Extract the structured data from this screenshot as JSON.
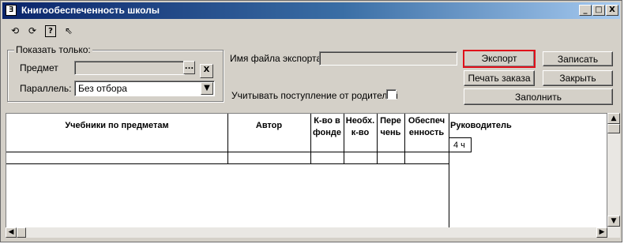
{
  "window": {
    "title": "Книгообеспеченность школы",
    "app_icon": "1c-app-icon"
  },
  "title_buttons": {
    "minimize": "_",
    "maximize": "□",
    "close": "X"
  },
  "toolbar": {
    "icons": [
      "refresh-left-icon",
      "refresh-right-icon",
      "help-icon",
      "context-help-icon"
    ]
  },
  "filter": {
    "group_label": "Показать только:",
    "subject_label": "Предмет",
    "subject_value": "",
    "select_button": "...",
    "clear_button": "X",
    "parallel_label": "Параллель:",
    "parallel_value": "Без отбора"
  },
  "export": {
    "file_label": "Имя файла экспорта",
    "file_value": "",
    "parents_label": "Учитывать поступление от родителей",
    "parents_checked": false
  },
  "buttons": {
    "export": "Экспорт",
    "save": "Записать",
    "print_order": "Печать заказа",
    "close": "Закрыть",
    "fill": "Заполнить"
  },
  "table": {
    "headers": {
      "textbooks": "Учебники по предметам",
      "author": "Автор",
      "in_fund_1": "К-во в",
      "in_fund_2": "фонде",
      "needed_1": "Необх.",
      "needed_2": "к-во",
      "list_1": "Пере",
      "list_2": "чень",
      "provision_1": "Обеспеч",
      "provision_2": "енность",
      "supervisor": "Руководитель",
      "class": "4 ч"
    }
  },
  "colors": {
    "highlight": "#e0101a",
    "titlebar_start": "#0a246a",
    "titlebar_end": "#a6caf0"
  }
}
